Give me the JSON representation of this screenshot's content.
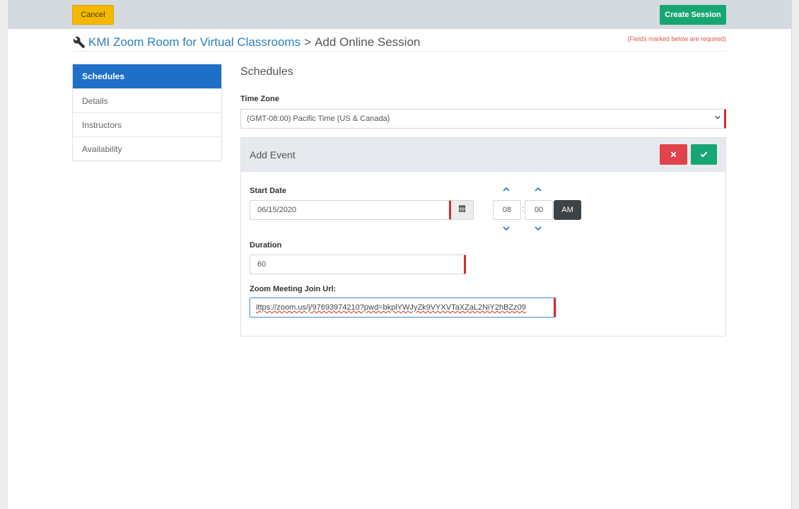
{
  "toolbar": {
    "cancel_label": "Cancel",
    "create_label": "Create Session"
  },
  "header": {
    "breadcrumb_link": "KMI Zoom Room for Virtual Classrooms",
    "breadcrumb_separator": ">",
    "breadcrumb_current": "Add Online Session",
    "required_note": "(Fields marked below are required)"
  },
  "sidebar": {
    "items": [
      {
        "label": "Schedules",
        "active": true
      },
      {
        "label": "Details",
        "active": false
      },
      {
        "label": "Instructors",
        "active": false
      },
      {
        "label": "Availability",
        "active": false
      }
    ]
  },
  "main": {
    "section_title": "Schedules",
    "timezone_label": "Time Zone",
    "timezone_value": "(GMT-08:00) Pacific Time (US & Canada)",
    "event": {
      "title": "Add Event",
      "start_date_label": "Start Date",
      "start_date_value": "06/15/2020",
      "hour": "08",
      "minute": "00",
      "time_separator": ":",
      "meridiem": "AM",
      "duration_label": "Duration",
      "duration_value": "60",
      "zoom_url_label": "Zoom Meeting Join Url:",
      "zoom_url_value": "ittps://zoom.us/j/97693974210?pwd=bkplYWJyZk9VYXVTaXZaL2NiY2hBZz09"
    }
  },
  "colors": {
    "topbar": "#d4dadf",
    "cancel": "#f5b800",
    "create": "#17a673",
    "active_nav": "#1f6fc8",
    "link": "#2d7fbd",
    "required": "#d62b2b",
    "delete": "#e0444a"
  },
  "icons": {
    "breadcrumb": "wrench-icon",
    "calendar": "calendar-icon",
    "delete": "times-icon",
    "confirm": "check-icon",
    "spinners": "chevron-icons",
    "select": "chevron-down-icon"
  }
}
